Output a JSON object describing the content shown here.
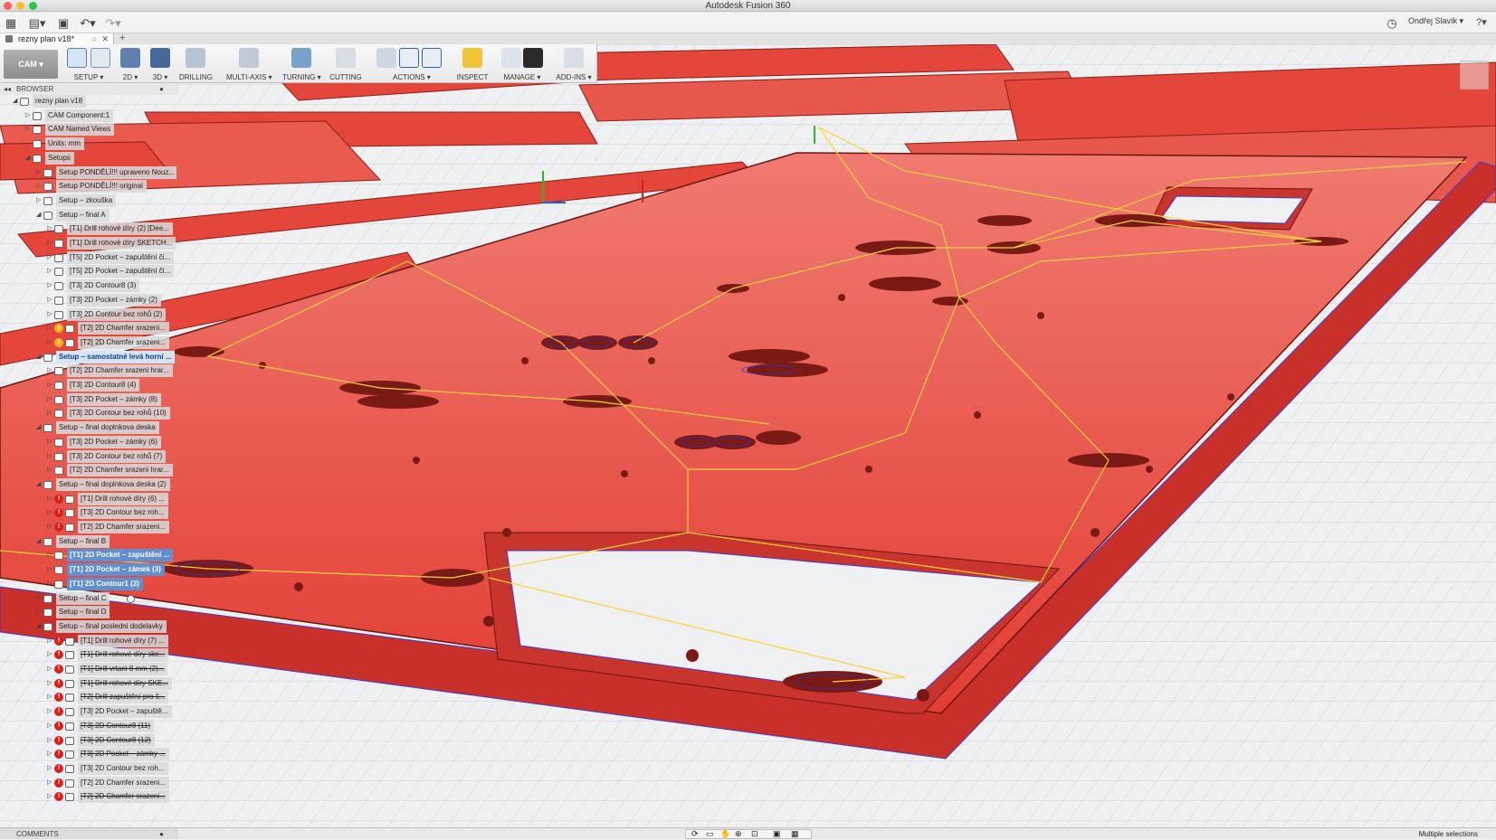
{
  "window": {
    "title": "Autodesk Fusion 360"
  },
  "appbar": {
    "user": "Ondřej Slavík ▾"
  },
  "document": {
    "tab_title": "rezny plan v18*"
  },
  "toolbar": {
    "workspace": "CAM ▾",
    "groups": [
      {
        "label": "SETUP ▾"
      },
      {
        "label": "2D ▾"
      },
      {
        "label": "3D ▾"
      },
      {
        "label": "DRILLING"
      },
      {
        "label": "MULTI-AXIS ▾"
      },
      {
        "label": "TURNING ▾"
      },
      {
        "label": "CUTTING"
      },
      {
        "label": "ACTIONS ▾"
      },
      {
        "label": "INSPECT"
      },
      {
        "label": "MANAGE ▾"
      },
      {
        "label": "ADD-INS ▾"
      }
    ]
  },
  "browser": {
    "title": "BROWSER",
    "nodes": [
      {
        "label": "rezny plan v18",
        "depth": 1,
        "tw": "◢",
        "icon": "file"
      },
      {
        "label": "CAM Component:1",
        "depth": 2,
        "tw": "▷",
        "icon": "component"
      },
      {
        "label": "CAM Named Views",
        "depth": 2,
        "tw": "▷",
        "icon": "folder"
      },
      {
        "label": "Units: mm",
        "depth": 2,
        "tw": "",
        "icon": "folder"
      },
      {
        "label": "Setups",
        "depth": 2,
        "tw": "◢",
        "icon": "folder"
      },
      {
        "label": "Setup PONDĚLÍ!!! upraveno Nouz...",
        "depth": 3,
        "tw": "▷",
        "icon": "setup"
      },
      {
        "label": "Setup PONDĚLÍ!!! original",
        "depth": 3,
        "tw": "▷",
        "icon": "setup"
      },
      {
        "label": "Setup – zkouška",
        "depth": 3,
        "tw": "▷",
        "icon": "setup"
      },
      {
        "label": "Setup – final A",
        "depth": 3,
        "tw": "◢",
        "icon": "setup"
      },
      {
        "label": "[T1] Drill rohové díry (2) [Dee...",
        "depth": 4,
        "tw": "▷",
        "icon": "drill"
      },
      {
        "label": "[T1] Drill rohové díry SKETCH...",
        "depth": 4,
        "tw": "▷",
        "icon": "drill"
      },
      {
        "label": "[T5] 2D Pocket – zapuštění či...",
        "depth": 4,
        "tw": "▷",
        "icon": "op"
      },
      {
        "label": "[T5] 2D Pocket – zapuštění či...",
        "depth": 4,
        "tw": "▷",
        "icon": "op"
      },
      {
        "label": "[T3] 2D Contour8 (3)",
        "depth": 4,
        "tw": "▷",
        "icon": "op"
      },
      {
        "label": "[T3] 2D Pocket – zámky (2)",
        "depth": 4,
        "tw": "▷",
        "icon": "op"
      },
      {
        "label": "[T3] 2D Contour bez rohů (2)",
        "depth": 4,
        "tw": "▷",
        "icon": "op"
      },
      {
        "label": "[T2] 2D Chamfer srazeni...",
        "depth": 4,
        "tw": "▷",
        "icon": "op",
        "status": "warn"
      },
      {
        "label": "[T2] 2D Chamfer srazeni...",
        "depth": 4,
        "tw": "▷",
        "icon": "op",
        "status": "warn"
      },
      {
        "label": "Setup – samostatné levá horní ...",
        "depth": 3,
        "tw": "◢",
        "icon": "setup",
        "hl": true
      },
      {
        "label": "[T2] 2D Chamfer srazeni hrar...",
        "depth": 4,
        "tw": "▷",
        "icon": "op"
      },
      {
        "label": "[T3] 2D Contour8 (4)",
        "depth": 4,
        "tw": "▷",
        "icon": "op"
      },
      {
        "label": "[T3] 2D Pocket – zámky (8)",
        "depth": 4,
        "tw": "▷",
        "icon": "op"
      },
      {
        "label": "[T3] 2D Contour bez rohů (10)",
        "depth": 4,
        "tw": "▷",
        "icon": "op"
      },
      {
        "label": "Setup – final doplnkova deska",
        "depth": 3,
        "tw": "◢",
        "icon": "setup"
      },
      {
        "label": "[T3] 2D Pocket – zámky (6)",
        "depth": 4,
        "tw": "▷",
        "icon": "op"
      },
      {
        "label": "[T3] 2D Contour bez rohů (7)",
        "depth": 4,
        "tw": "▷",
        "icon": "op"
      },
      {
        "label": "[T2] 2D Chamfer srazeni hrar...",
        "depth": 4,
        "tw": "▷",
        "icon": "op"
      },
      {
        "label": "Setup – final doplnkova deska (2)",
        "depth": 3,
        "tw": "◢",
        "icon": "setup"
      },
      {
        "label": "[T1] Drill rohové díry (6) ...",
        "depth": 4,
        "tw": "▷",
        "icon": "drill",
        "status": "err"
      },
      {
        "label": "[T3] 2D Contour bez roh...",
        "depth": 4,
        "tw": "▷",
        "icon": "op",
        "status": "err"
      },
      {
        "label": "[T2] 2D Chamfer srazeni...",
        "depth": 4,
        "tw": "▷",
        "icon": "op",
        "status": "err"
      },
      {
        "label": "Setup – final B",
        "depth": 3,
        "tw": "◢",
        "icon": "setup"
      },
      {
        "label": "[T1] 2D Pocket – zapuštění ...",
        "depth": 4,
        "tw": "▷",
        "icon": "op",
        "sel": true
      },
      {
        "label": "[T1] 2D Pocket – zámek (3)",
        "depth": 4,
        "tw": "▷",
        "icon": "op",
        "sel": true
      },
      {
        "label": "[T1] 2D Contour1 (3)",
        "depth": 4,
        "tw": "▷",
        "icon": "op",
        "sel": true
      },
      {
        "label": "Setup – final C",
        "depth": 3,
        "tw": "▷",
        "icon": "setup",
        "radio": true
      },
      {
        "label": "Setup – final D",
        "depth": 3,
        "tw": "▷",
        "icon": "setup"
      },
      {
        "label": "Setup – final posledni dodelavky",
        "depth": 3,
        "tw": "◢",
        "icon": "setup"
      },
      {
        "label": "[T1] Drill rohové díry (7) ...",
        "depth": 4,
        "tw": "▷",
        "icon": "drill",
        "status": "err"
      },
      {
        "label": "[T1] Drill rohové díry ske...",
        "depth": 4,
        "tw": "▷",
        "icon": "drill",
        "status": "err",
        "sup": true
      },
      {
        "label": "[T1] Drill vrtani 8 mm (2)...",
        "depth": 4,
        "tw": "▷",
        "icon": "drill",
        "status": "err",
        "sup": true
      },
      {
        "label": "[T1] Drill rohové díry SKE...",
        "depth": 4,
        "tw": "▷",
        "icon": "drill",
        "status": "err",
        "sup": true
      },
      {
        "label": "[T2] Drill zapuštění pro š...",
        "depth": 4,
        "tw": "▷",
        "icon": "drill",
        "status": "err",
        "sup": true
      },
      {
        "label": "[T3] 2D Pocket – zapuště...",
        "depth": 4,
        "tw": "▷",
        "icon": "op",
        "status": "err"
      },
      {
        "label": "[T3] 2D Contour8 (11)",
        "depth": 4,
        "tw": "▷",
        "icon": "op",
        "status": "err",
        "sup": true
      },
      {
        "label": "[T3] 2D Contour8 (12)",
        "depth": 4,
        "tw": "▷",
        "icon": "op",
        "status": "err",
        "sup": true
      },
      {
        "label": "[T3] 2D Pocket – zámky ...",
        "depth": 4,
        "tw": "▷",
        "icon": "op",
        "status": "err",
        "sup": true
      },
      {
        "label": "[T3] 2D Contour bez roh...",
        "depth": 4,
        "tw": "▷",
        "icon": "op",
        "status": "err"
      },
      {
        "label": "[T2] 2D Chamfer srazeni...",
        "depth": 4,
        "tw": "▷",
        "icon": "op",
        "status": "err"
      },
      {
        "label": "[T2] 2D Chamfer srazeni...",
        "depth": 4,
        "tw": "▷",
        "icon": "op",
        "status": "err",
        "sup": true
      }
    ]
  },
  "comments": {
    "label": "COMMENTS"
  },
  "statusbar": {
    "text": "Multiple selections"
  },
  "colors": {
    "stock": "#e4463b",
    "stock_light": "#f07a70",
    "toolpath": "#ffd23a",
    "accent": "#5f8fcf"
  }
}
